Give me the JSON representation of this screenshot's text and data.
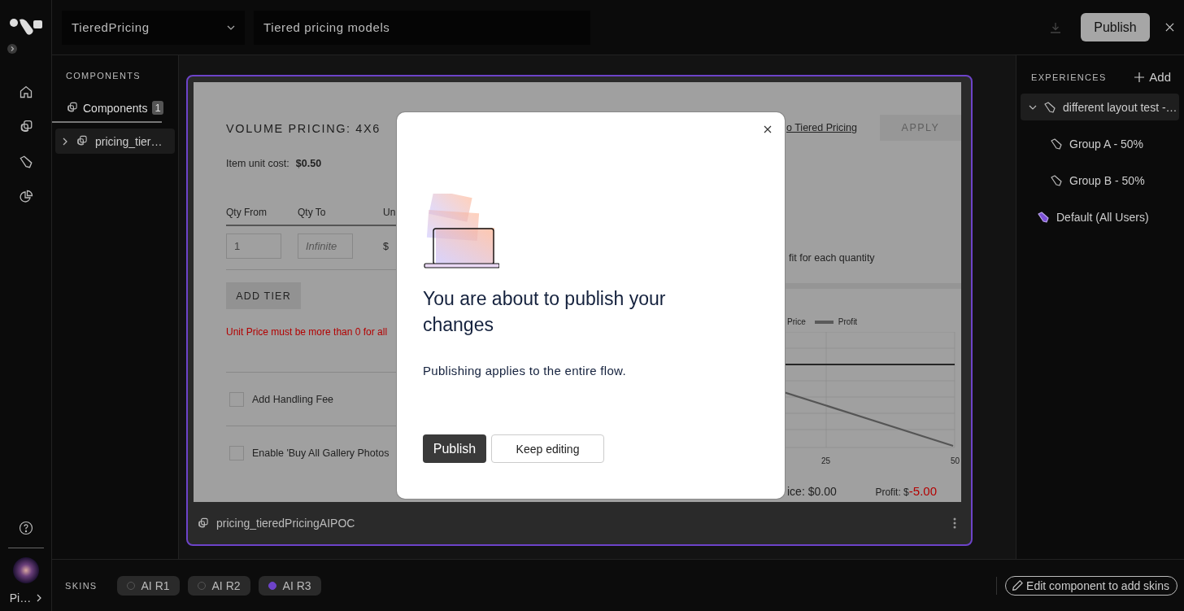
{
  "rail": {
    "user_label": "Pi…"
  },
  "header": {
    "flow_select": "TieredPricing",
    "description": "Tiered pricing models",
    "publish": "Publish"
  },
  "components_panel": {
    "heading": "COMPONENTS",
    "tab": {
      "label": "Components",
      "count": "1"
    },
    "tree": [
      {
        "label": "pricing_tier…",
        "expanded": false
      }
    ]
  },
  "preview": {
    "title": "VOLUME PRICING: 4X6",
    "link": "o Tiered Pricing",
    "apply": {
      "label": "APPLY",
      "disabled": true
    },
    "unit_cost_label": "Item unit cost:",
    "unit_cost": "$0.50",
    "columns": [
      "Qty From",
      "Qty To",
      "Un"
    ],
    "tier": {
      "from": "1",
      "to_placeholder": "Infinite",
      "currency": "$"
    },
    "add_tier": "ADD TIER",
    "error": "Unit Price must be more than 0 for all",
    "options": [
      {
        "label": "Add Handling Fee",
        "checked": false
      },
      {
        "label": "Enable 'Buy All Gallery Photos",
        "checked": false
      }
    ],
    "chart_caption": "fit for each quantity",
    "legend": [
      "Price",
      "Profit"
    ],
    "x_ticks": [
      "25",
      "50"
    ],
    "price_summary": "ice: $0.00",
    "profit_label": "Profit: $",
    "profit_value": "-5.00"
  },
  "footer": {
    "name": "pricing_tieredPricingAIPOC"
  },
  "experiences": {
    "heading": "EXPERIENCES",
    "add": "Add",
    "items": [
      {
        "label": "different layout test -…",
        "kind": "test",
        "selected": true,
        "expanded": true,
        "children": [
          {
            "label": "Group A - 50%",
            "selected": false
          },
          {
            "label": "Group B - 50%",
            "selected": false
          }
        ]
      },
      {
        "label": "Default (All Users)",
        "kind": "default",
        "selected": false
      }
    ]
  },
  "skins": {
    "label": "SKINS",
    "items": [
      {
        "label": "AI R1",
        "selected": false
      },
      {
        "label": "AI R2",
        "selected": false
      },
      {
        "label": "AI R3",
        "selected": true
      }
    ],
    "edit": "Edit component to add skins"
  },
  "modal": {
    "title": "You are about to publish your changes",
    "body": "Publishing applies to the entire flow.",
    "primary": "Publish",
    "secondary": "Keep editing"
  }
}
